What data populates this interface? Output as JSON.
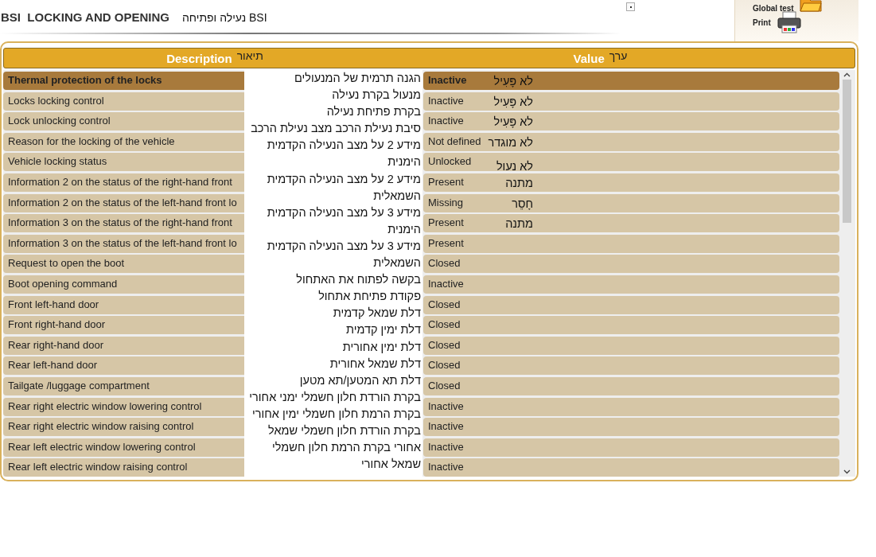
{
  "header": {
    "title": "BSI  LOCKING AND OPENING",
    "title_translation": "BSI נעילה ופתיחה"
  },
  "tools": [
    {
      "kind": "folder",
      "label": "Global test"
    },
    {
      "kind": "printer",
      "label": "Print"
    }
  ],
  "table": {
    "description_header": {
      "label": "Description",
      "translation": "תיאור"
    },
    "value_header": {
      "label": "Value",
      "translation": "ערך"
    },
    "rows": [
      {
        "description": "Thermal protection of the locks",
        "value": "Inactive",
        "value_translation": "לא פָּעִיל",
        "selected": true
      },
      {
        "description": "Locks locking control",
        "value": "Inactive",
        "value_translation": "לא פָּעִיל",
        "selected": false
      },
      {
        "description": "Lock unlocking control",
        "value": "Inactive",
        "value_translation": "לא פָּעִיל",
        "selected": false
      },
      {
        "description": "Reason for the locking of the vehicle",
        "value": "Not defined",
        "value_translation": "לא מוגדר",
        "selected": false
      },
      {
        "description": "Vehicle locking status",
        "value": "Unlocked",
        "value_translation": "לא נעול",
        "selected": false
      },
      {
        "description": "Information 2 on the status of the right-hand front",
        "value": "Present",
        "value_translation": "מתנה",
        "selected": false
      },
      {
        "description": "Information 2 on the status of the left-hand front lo",
        "value": "Missing",
        "value_translation": "חָסֵר",
        "selected": false
      },
      {
        "description": "Information 3 on the status of the right-hand front",
        "value": "Present",
        "value_translation": "מתנה",
        "selected": false
      },
      {
        "description": "Information 3 on the status of the left-hand front lo",
        "value": "Present",
        "selected": false
      },
      {
        "description": "Request to open the boot",
        "value": "Closed",
        "selected": false
      },
      {
        "description": "Boot opening command",
        "value": "Inactive",
        "selected": false
      },
      {
        "description": "Front left-hand door",
        "value": "Closed",
        "selected": false
      },
      {
        "description": "Front right-hand door",
        "value": "Closed",
        "selected": false
      },
      {
        "description": "Rear right-hand door",
        "value": "Closed",
        "selected": false
      },
      {
        "description": "Rear left-hand door",
        "value": "Closed",
        "selected": false
      },
      {
        "description": "Tailgate /luggage compartment",
        "value": "Closed",
        "selected": false
      },
      {
        "description": "Rear right electric window lowering control",
        "value": "Inactive",
        "selected": false
      },
      {
        "description": "Rear right electric window raising control",
        "value": "Inactive",
        "selected": false
      },
      {
        "description": "Rear left electric window lowering control",
        "value": "Inactive",
        "selected": false
      },
      {
        "description": "Rear left electric window raising control",
        "value": "Inactive",
        "selected": false
      }
    ]
  },
  "translation_overlay": {
    "lines": [
      "הגנה תרמית של המנעולים",
      "מנעול בקרת נעילה",
      "בקרת פתיחת נעילה",
      "סיבת נעילת הרכב מצב נעילת הרכב",
      "מידע 2 על מצב הנעילה הקדמית",
      "הימנית",
      "מידע 2 על מצב הנעילה הקדמית",
      "השמאלית",
      "מידע 3 על מצב הנעילה הקדמית",
      "הימנית",
      "מידע 3 על מצב הנעילה הקדמית",
      "השמאלית",
      "בקשה לפתוח את האתחול",
      "פקודת פתיחת אתחול",
      "דלת שמאל קדמית",
      "דלת ימין קדמית",
      "דלת ימין אחורית",
      "דלת שמאל אחורית",
      "דלת תא המטען/תא מטען",
      "בקרת הורדת חלון חשמלי ימני אחורי",
      "בקרת הרמת חלון חשמלי ימין אחורי",
      "בקרת הורדת חלון חשמלי שמאל",
      "אחורי בקרת הרמת חלון חשמלי",
      "שמאל אחורי"
    ]
  }
}
